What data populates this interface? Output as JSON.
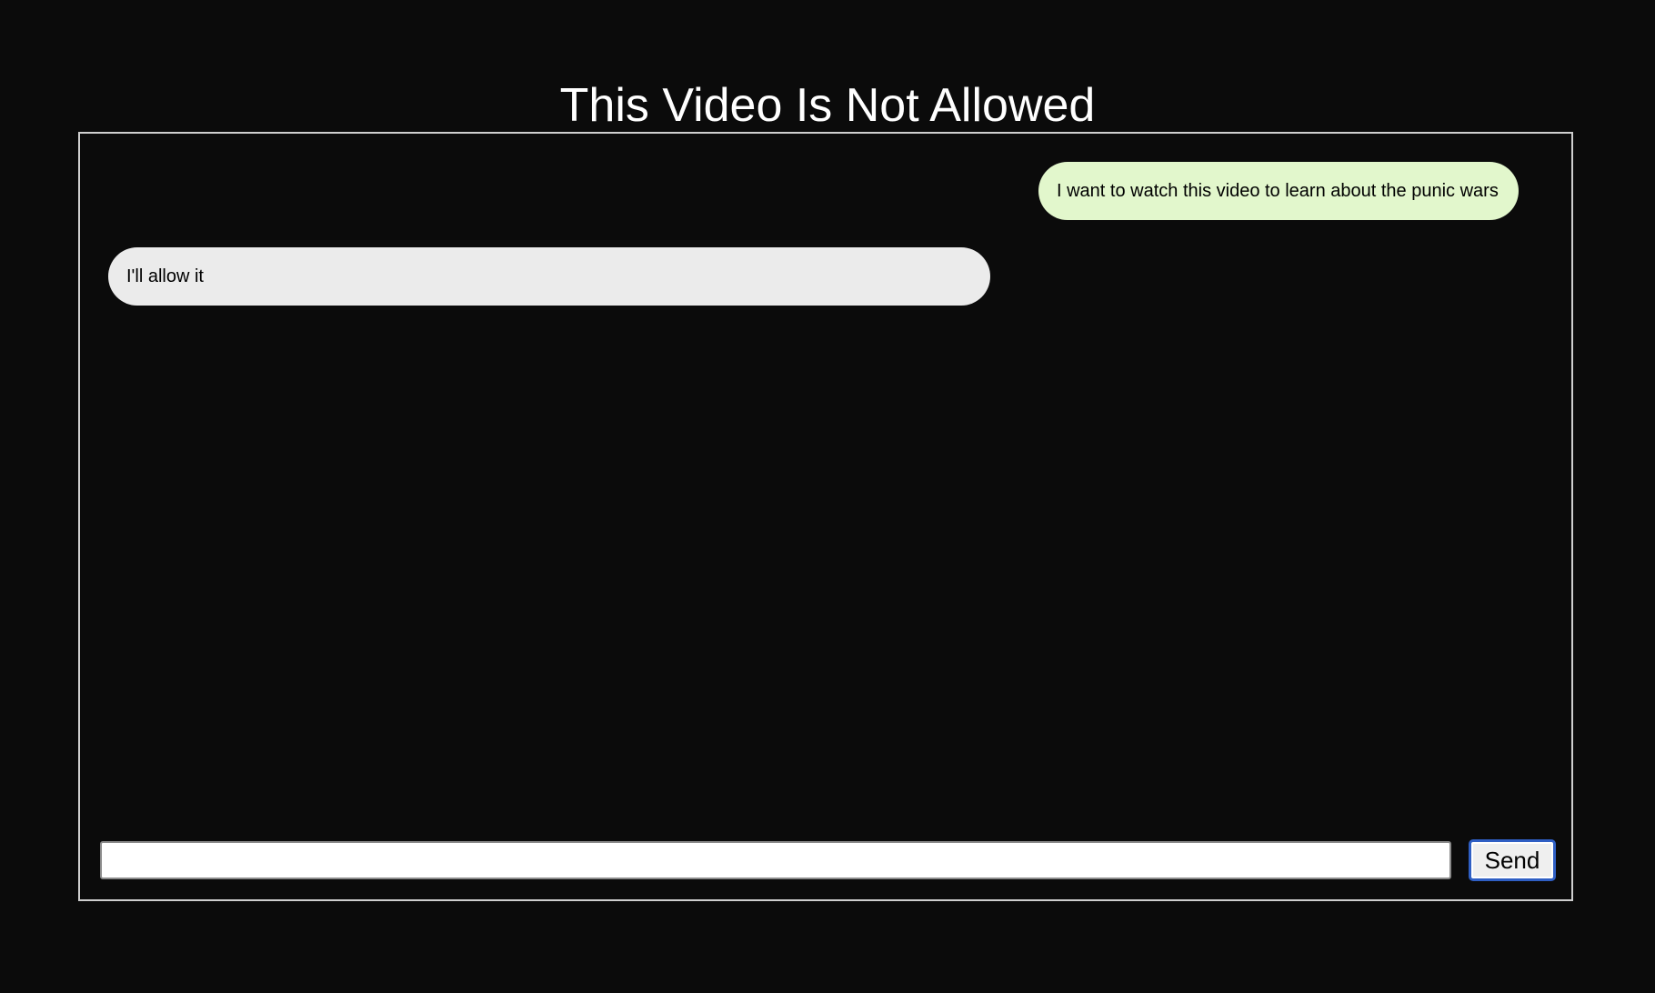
{
  "page": {
    "title": "This Video Is Not Allowed"
  },
  "chat": {
    "messages": [
      {
        "role": "user",
        "text": "I want to watch this video to learn about the punic wars"
      },
      {
        "role": "assistant",
        "text": "I'll allow it"
      }
    ],
    "input": {
      "value": "",
      "placeholder": ""
    },
    "send_label": "Send"
  },
  "colors": {
    "background": "#0b0b0b",
    "user_bubble": "#e2f7cc",
    "assistant_bubble": "#ebebeb",
    "panel_border": "#cfcfcf",
    "send_focus_ring": "#2f5fc4"
  }
}
